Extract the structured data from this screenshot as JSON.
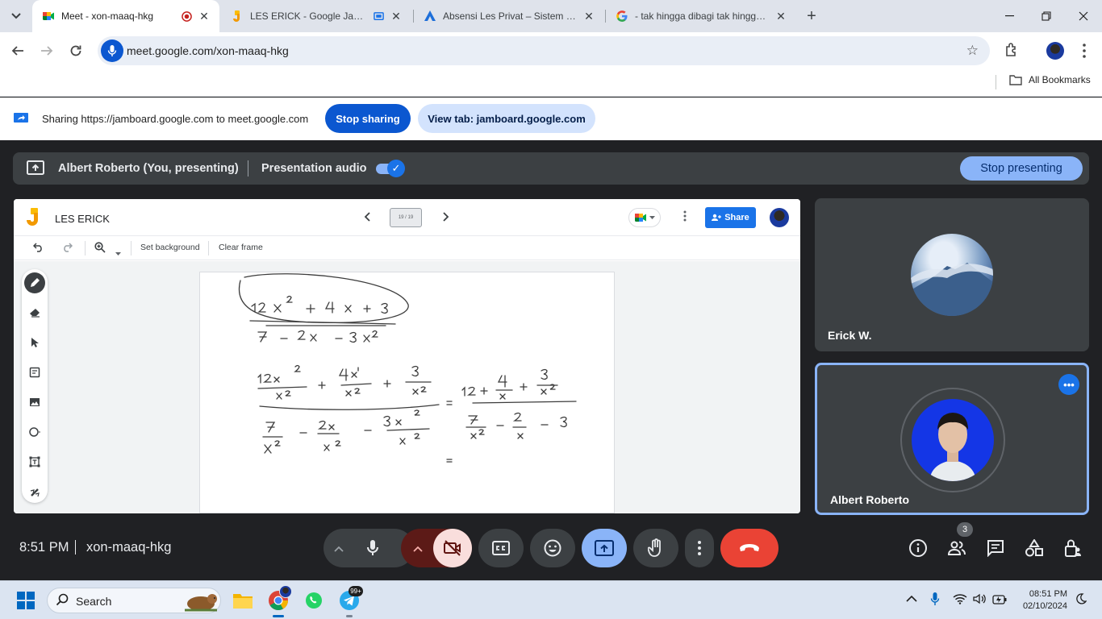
{
  "browser": {
    "tabs": [
      {
        "title": "Meet - xon-maaq-hkg",
        "active": true,
        "recording": true
      },
      {
        "title": "LES ERICK - Google Jamboard",
        "active": false
      },
      {
        "title": "Absensi Les Privat – Sistem Ruang Guru",
        "active": false
      },
      {
        "title": "- tak hingga dibagi tak hingga - Google Search",
        "active": false
      }
    ],
    "url": "meet.google.com/xon-maaq-hkg",
    "all_bookmarks": "All Bookmarks"
  },
  "sharing_bar": {
    "text": "Sharing https://jamboard.google.com to meet.google.com",
    "stop_sharing": "Stop sharing",
    "view_tab": "View tab: jamboard.google.com"
  },
  "presenting_bar": {
    "presenter": "Albert Roberto (You, presenting)",
    "audio_label": "Presentation audio",
    "audio_enabled": true,
    "stop_presenting": "Stop presenting"
  },
  "jamboard": {
    "title": "LES ERICK",
    "frame_indicator": "19 / 19",
    "share": "Share",
    "set_background": "Set background",
    "clear_frame": "Clear frame"
  },
  "participants": [
    {
      "name": "Erick W."
    },
    {
      "name": "Albert Roberto",
      "active_speaker_frame": true
    }
  ],
  "meeting": {
    "time": "8:51 PM",
    "code": "xon-maaq-hkg",
    "participant_count": "3"
  },
  "taskbar": {
    "search_placeholder": "Search",
    "telegram_badge": "99+",
    "time": "08:51 PM",
    "date": "02/10/2024"
  },
  "colors": {
    "meet_bg": "#202124",
    "tile_bg": "#3c4043",
    "accent_blue": "#8ab4f8",
    "chrome_blue": "#0b57d0",
    "end_call_red": "#ea4335"
  }
}
